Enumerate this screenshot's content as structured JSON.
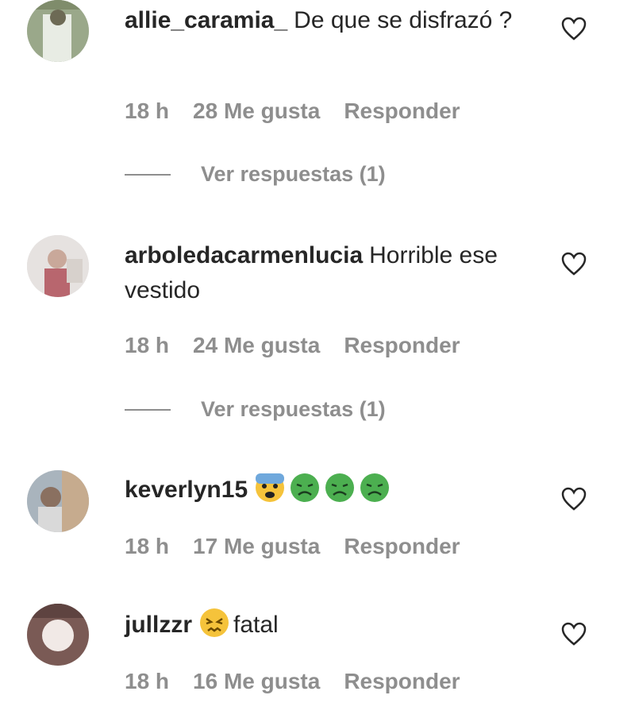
{
  "comments": [
    {
      "username": "allie_caramia_",
      "text": "De que se disfrazó ?",
      "time": "18 h",
      "likes": "28 Me gusta",
      "reply": "Responder",
      "view_replies": "Ver respuestas (1)"
    },
    {
      "username": "arboledacarmenlucia",
      "text": "Horrible ese vestido",
      "time": "18 h",
      "likes": "24 Me gusta",
      "reply": "Responder",
      "view_replies": "Ver respuestas (1)"
    },
    {
      "username": "keverlyn15",
      "emojis": [
        "anxious-face-emoji",
        "nauseated-face-emoji",
        "nauseated-face-emoji",
        "nauseated-face-emoji"
      ],
      "text": "",
      "time": "18 h",
      "likes": "17 Me gusta",
      "reply": "Responder"
    },
    {
      "username": "jullzzr",
      "emojis": [
        "confounded-face-emoji"
      ],
      "text": "fatal",
      "time": "18 h",
      "likes": "16 Me gusta",
      "reply": "Responder"
    }
  ],
  "colors": {
    "text": "#262626",
    "secondary": "#8e8e8e",
    "nauseated_green": "#4caf50",
    "emoji_yellow": "#f5c33b"
  }
}
